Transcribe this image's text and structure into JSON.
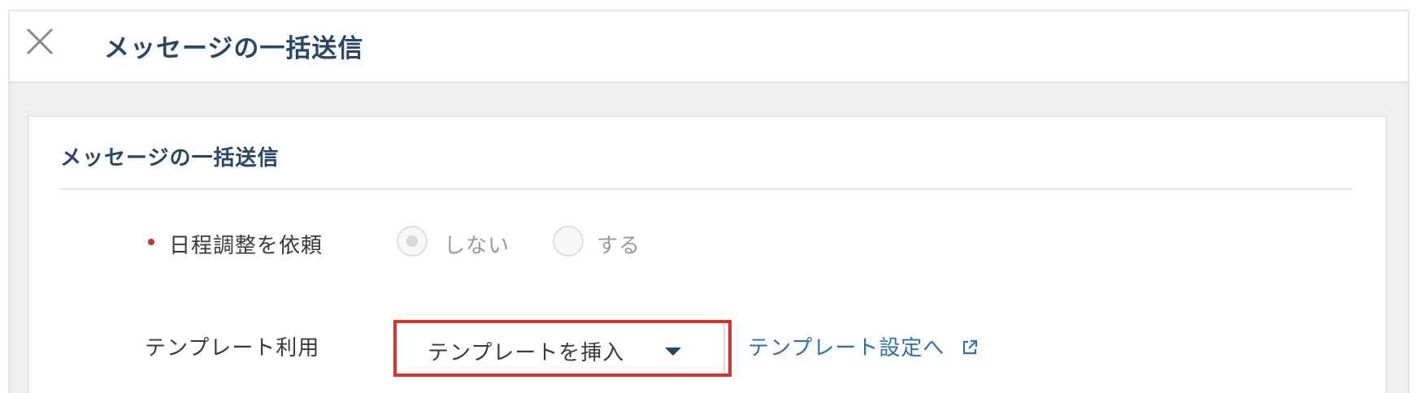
{
  "header": {
    "close_icon": "close-icon",
    "title": "メッセージの一括送信"
  },
  "card": {
    "title": "メッセージの一括送信",
    "schedule": {
      "label": "日程調整を依頼",
      "required": true,
      "options": [
        {
          "label": "しない",
          "selected": true
        },
        {
          "label": "する",
          "selected": false
        }
      ]
    },
    "template": {
      "label": "テンプレート利用",
      "dropdown_label": "テンプレートを挿入",
      "settings_link": "テンプレート設定へ",
      "external_icon": "external-link-icon"
    }
  },
  "colors": {
    "title_navy": "#26466b",
    "required_red": "#c8352d",
    "highlight_red": "#d9332b",
    "link_blue": "#2a6fb8"
  }
}
